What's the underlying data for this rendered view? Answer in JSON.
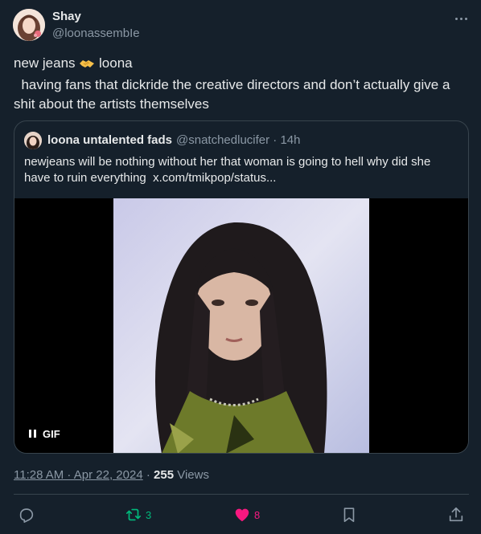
{
  "author": {
    "display_name": "Shay",
    "handle": "@loonassembIe"
  },
  "tweet": {
    "text_line1_before": "new jeans ",
    "emoji": "handshake",
    "text_line1_after": " loona",
    "text_line2": "  having fans that dickride the creative directors and don’t actually give a",
    "text_line3": "shit about the artists themselves"
  },
  "quote": {
    "display_name": "loona untalented fads",
    "handle_time": "@snatchedlucifer · 14h",
    "text_line1": "newjeans will be nothing without her that woman is going to hell why did she",
    "text_line2": "have to ruin everything  x.com/tmikpop/status...",
    "media_badge": "GIF"
  },
  "meta": {
    "timestamp": "11:28 AM · Apr 22, 2024",
    "separator": " · ",
    "views_count": "255",
    "views_label": " Views"
  },
  "actions": {
    "reply_count": "",
    "retweet_count": "3",
    "like_count": "8"
  },
  "colors": {
    "background": "#15202b",
    "text": "#e7e9ea",
    "secondary_text": "#8b98a5",
    "border": "#38444d",
    "retweet": "#00ba7c",
    "like": "#f91880"
  },
  "icons": [
    "more-icon",
    "pause-icon",
    "reply-icon",
    "retweet-icon",
    "heart-icon",
    "bookmark-icon",
    "share-icon"
  ]
}
